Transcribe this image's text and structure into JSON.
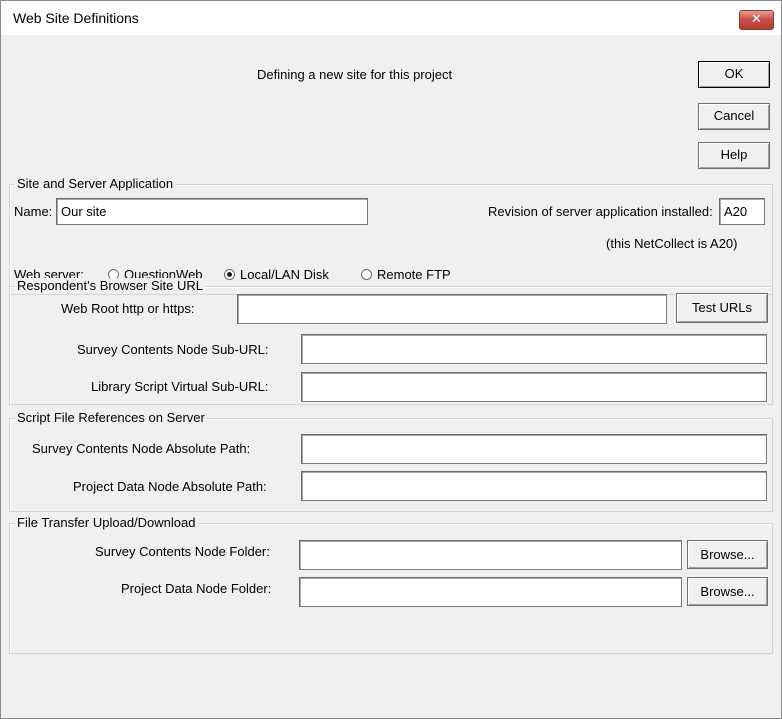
{
  "window": {
    "title": "Web Site Definitions",
    "close_glyph": "✕"
  },
  "header": {
    "message": "Defining a new site for this project"
  },
  "buttons": {
    "ok": "OK",
    "cancel": "Cancel",
    "help": "Help"
  },
  "site_server": {
    "legend": "Site and Server Application",
    "name_label": "Name:",
    "name_value": "Our site",
    "revision_label": "Revision of server application installed:",
    "revision_value": "A20",
    "netcollect_note": "(this NetCollect is A20)",
    "web_server_label": "Web server:",
    "options": [
      {
        "label": "QuestionWeb",
        "selected": false
      },
      {
        "label": "Local/LAN Disk",
        "selected": true
      },
      {
        "label": "Remote FTP",
        "selected": false
      }
    ]
  },
  "browser_url": {
    "legend": "Respondent's Browser Site URL",
    "web_root_label": "Web Root http or https:",
    "web_root_value": "",
    "test_urls": "Test URLs",
    "contents_sub_url_label": "Survey Contents Node Sub-URL:",
    "contents_sub_url_value": "",
    "library_sub_url_label": "Library Script Virtual Sub-URL:",
    "library_sub_url_value": ""
  },
  "script_refs": {
    "legend": "Script File References on Server",
    "contents_path_label": "Survey Contents Node Absolute Path:",
    "contents_path_value": "",
    "data_path_label": "Project Data Node Absolute Path:",
    "data_path_value": ""
  },
  "file_transfer": {
    "legend": "File Transfer Upload/Download",
    "contents_folder_label": "Survey Contents Node Folder:",
    "contents_folder_value": "",
    "data_folder_label": "Project Data Node Folder:",
    "data_folder_value": "",
    "browse": "Browse..."
  }
}
